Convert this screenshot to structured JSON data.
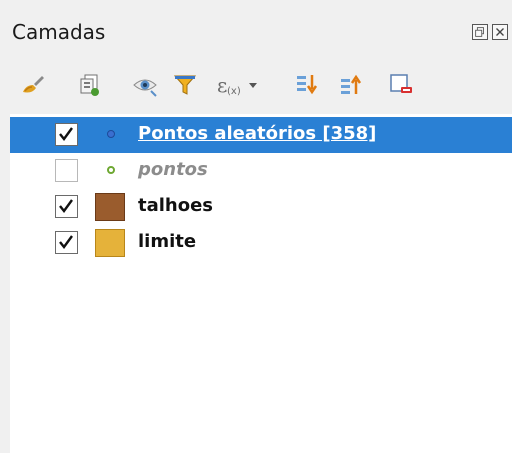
{
  "panel": {
    "title": "Camadas"
  },
  "toolbar": {
    "tools": [
      {
        "name": "style-brush-icon"
      },
      {
        "name": "add-group-icon"
      },
      {
        "name": "visibility-eye-icon"
      },
      {
        "name": "filter-funnel-icon"
      },
      {
        "name": "expression-filter-icon"
      },
      {
        "name": "expand-all-icon"
      },
      {
        "name": "collapse-all-icon"
      },
      {
        "name": "remove-layer-icon"
      }
    ]
  },
  "layers": [
    {
      "label": "Pontos aleatórios [358]",
      "checked": true,
      "selected": true,
      "symbol": "point",
      "color": "#3a6fd0"
    },
    {
      "label": "pontos",
      "checked": false,
      "selected": false,
      "symbol": "point",
      "color": "#6ea832"
    },
    {
      "label": "talhoes",
      "checked": true,
      "selected": false,
      "symbol": "polygon",
      "color": "#9a5c2d"
    },
    {
      "label": "limite",
      "checked": true,
      "selected": false,
      "symbol": "polygon",
      "color": "#e5b23a"
    }
  ],
  "colors": {
    "selection": "#2a80d4",
    "panel_bg": "#f0f0f0",
    "tree_bg": "#ffffff"
  }
}
